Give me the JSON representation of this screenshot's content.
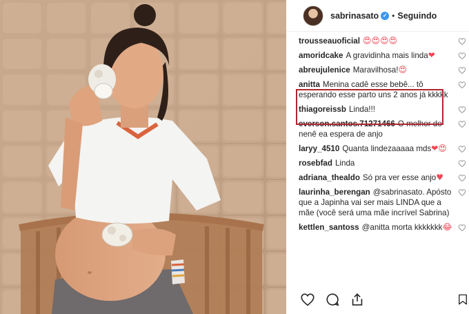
{
  "header": {
    "username": "sabrinasato",
    "separator": "•",
    "follow_label": "Seguindo",
    "verified_icon": "verified-badge-icon"
  },
  "comments": [
    {
      "user": "trousseauoficial",
      "text": "",
      "emoji": "😍😍😍😍"
    },
    {
      "user": "amoridcake",
      "text": "A gravidinha mais linda",
      "emoji": "❤"
    },
    {
      "user": "abreujulenice",
      "text": "Maravilhosa!",
      "emoji": "😍"
    },
    {
      "user": "anitta",
      "text": "Menina cadê esse bebê... tô esperando esse parto uns 2 anos já kkkkk",
      "emoji": ""
    },
    {
      "user": "thiagoreissb",
      "text": "Linda!!!",
      "emoji": ""
    },
    {
      "user": "everson.santos.71271466",
      "text": "O melhor do nenê ea espera de anjo",
      "emoji": ""
    },
    {
      "user": "laryy_4510",
      "text": "Quanta lindezaaaaa mds",
      "emoji": "❤😍"
    },
    {
      "user": "rosebfad",
      "text": "Linda",
      "emoji": ""
    },
    {
      "user": "adriana_thealdo",
      "text": "Só pra ver esse anjo",
      "emoji": "♥"
    },
    {
      "user": "laurinha_berengan",
      "text": "@sabrinasato. Apósto que a Japinha vai ser mais LINDA que a mãe (você será uma mãe incrível Sabrina)",
      "emoji": ""
    },
    {
      "user": "kettlen_santoss",
      "text": "@anitta morta kkkkkkk",
      "emoji": "😂"
    }
  ],
  "actions": {
    "like_icon": "heart-outline-icon",
    "comment_icon": "comment-bubble-icon",
    "share_icon": "share-icon",
    "save_icon": "bookmark-icon"
  },
  "colors": {
    "highlight_border": "#b0252e",
    "verified_blue": "#3897f0",
    "emoji_heart": "#ed4956"
  }
}
